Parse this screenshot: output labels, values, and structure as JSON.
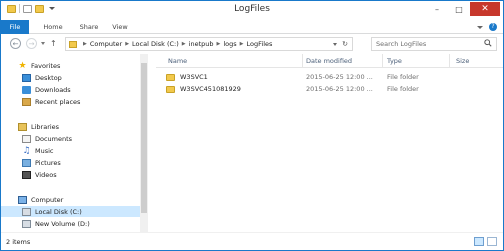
{
  "window": {
    "title": "LogFiles"
  },
  "ribbon": {
    "tabs": [
      "File",
      "Home",
      "Share",
      "View"
    ]
  },
  "address": {
    "crumbs": [
      "Computer",
      "Local Disk (C:)",
      "inetpub",
      "logs",
      "LogFiles"
    ]
  },
  "search": {
    "placeholder": "Search LogFiles"
  },
  "navpane": {
    "favorites": {
      "label": "Favorites",
      "items": [
        "Desktop",
        "Downloads",
        "Recent places"
      ]
    },
    "libraries": {
      "label": "Libraries",
      "items": [
        "Documents",
        "Music",
        "Pictures",
        "Videos"
      ]
    },
    "computer": {
      "label": "Computer",
      "items": [
        "Local Disk (C:)",
        "New Volume (D:)"
      ]
    }
  },
  "content": {
    "columns": [
      "Name",
      "Date modified",
      "Type",
      "Size"
    ],
    "rows": [
      {
        "name": "W3SVC1",
        "date": "2015-06-25 12:00 ...",
        "type": "File folder",
        "size": ""
      },
      {
        "name": "W3SVC451081929",
        "date": "2015-06-25 12:00 ...",
        "type": "File folder",
        "size": ""
      }
    ]
  },
  "status": {
    "count": "2 items"
  },
  "colors": {
    "accent": "#1979ca",
    "selection": "#cce8ff",
    "close": "#c7382c"
  },
  "icons": [
    "folder-icon",
    "star-icon",
    "desktop-icon",
    "downloads-icon",
    "recent-places-icon",
    "library-icon",
    "documents-icon",
    "music-icon",
    "pictures-icon",
    "videos-icon",
    "computer-icon",
    "drive-icon",
    "search-icon",
    "refresh-icon",
    "back-arrow-icon",
    "forward-arrow-icon",
    "up-arrow-icon",
    "help-icon"
  ]
}
